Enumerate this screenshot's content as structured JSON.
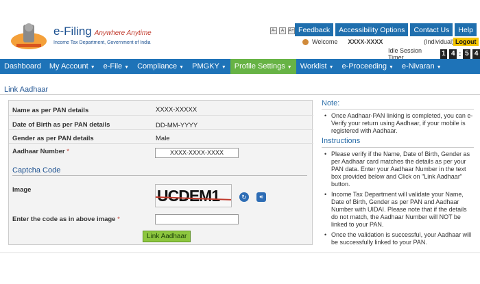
{
  "header": {
    "brand_title": "e-Filing",
    "brand_tagline": "Anywhere Anytime",
    "brand_subtitle": "Income Tax Department, Government of India",
    "font_buttons": [
      "A-",
      "A",
      "A+",
      "A",
      "A"
    ],
    "top_nav": [
      "Feedback",
      "Accessibility Options",
      "Contact Us",
      "Help"
    ],
    "welcome_label": "Welcome",
    "user_name": "XXXX-XXXX",
    "user_type": "(Individual)",
    "logout_label": "Logout",
    "session_label": "Idle Session Timer",
    "timer_minutes": "14",
    "timer_seconds": "54"
  },
  "main_nav": {
    "items": [
      {
        "label": "Dashboard",
        "has_dropdown": false
      },
      {
        "label": "My Account",
        "has_dropdown": true
      },
      {
        "label": "e-File",
        "has_dropdown": true
      },
      {
        "label": "Compliance",
        "has_dropdown": true
      },
      {
        "label": "PMGKY",
        "has_dropdown": true
      },
      {
        "label": "Profile Settings",
        "has_dropdown": true,
        "active": true
      },
      {
        "label": "Worklist",
        "has_dropdown": true
      },
      {
        "label": "e-Proceeding",
        "has_dropdown": true
      },
      {
        "label": "e-Nivaran",
        "has_dropdown": true
      }
    ]
  },
  "page": {
    "title": "Link Aadhaar"
  },
  "form": {
    "name_label": "Name as per PAN details",
    "name_value": "XXXX-XXXXX",
    "dob_label": "Date of Birth as per PAN details",
    "dob_value": "DD-MM-YYYY",
    "gender_label": "Gender as per PAN details",
    "gender_value": "Male",
    "aadhaar_label": "Aadhaar Number",
    "aadhaar_value": "XXXX-XXXX-XXXX",
    "required_mark": "*",
    "captcha_heading": "Captcha Code",
    "image_label": "Image",
    "captcha_text": "UCDEM1",
    "code_label": "Enter the code as in above image",
    "code_value": "",
    "submit_label": "Link Aadhaar"
  },
  "right_panel": {
    "note_heading": "Note:",
    "note_items": [
      "Once Aadhaar-PAN linking is completed, you can e-Verify your return using Aadhaar, if your mobile is registered with Aadhaar."
    ],
    "instructions_heading": "Instructions",
    "instruction_items": [
      "Please verify if the Name, Date of Birth, Gender as per Aadhaar card matches the details as per your PAN data. Enter your Aadhaar Number in the text box provided below and Click on \"Link Aadhaar\" button.",
      "Income Tax Department will validate your Name, Date of Birth, Gender as per PAN and Aadhaar Number with UIDAI. Please note that if the details do not match, the Aadhaar Number will NOT be linked to your PAN.",
      "Once the validation is successful, your Aadhaar will be successfully linked to your PAN."
    ]
  },
  "colors": {
    "nav_blue": "#1e73b8",
    "nav_active_green": "#67b345",
    "button_green": "#8dc63f",
    "heading_blue": "#2a6da8",
    "logout_yellow": "#f5c400"
  }
}
